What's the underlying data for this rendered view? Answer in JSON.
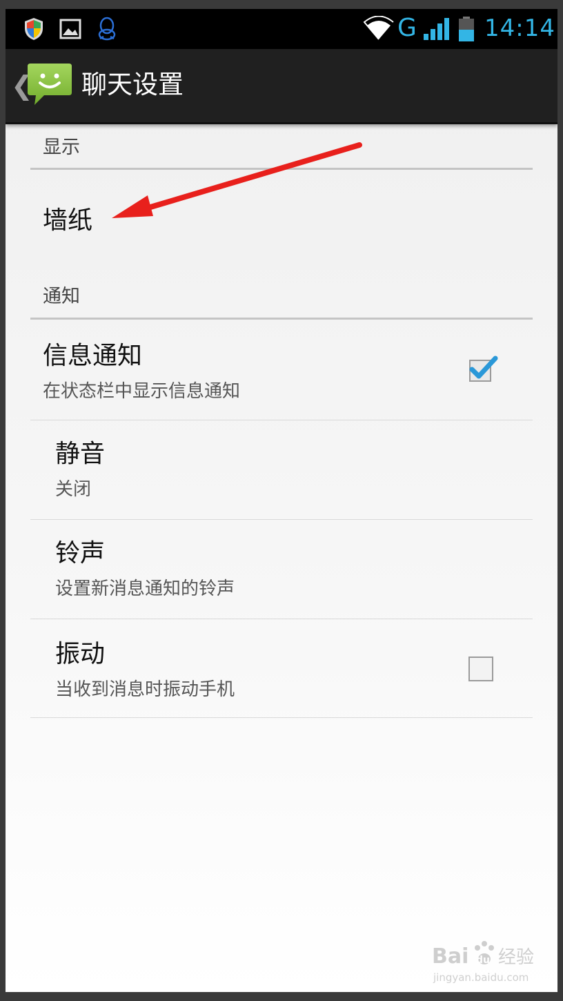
{
  "status_bar": {
    "network_label": "G",
    "time": "14:14",
    "icons": [
      "shield-icon",
      "picture-icon",
      "qq-penguin-icon",
      "wifi-icon",
      "signal-bars-icon",
      "battery-icon"
    ]
  },
  "action_bar": {
    "title": "聊天设置",
    "icons": [
      "back-chevron-icon",
      "messaging-app-icon"
    ]
  },
  "sections": {
    "display": {
      "header": "显示",
      "items": [
        {
          "title": "墙纸"
        }
      ]
    },
    "notifications": {
      "header": "通知",
      "items": [
        {
          "title": "信息通知",
          "summary": "在状态栏中显示信息通知",
          "checkbox": true
        },
        {
          "title": "静音",
          "summary": "关闭"
        },
        {
          "title": "铃声",
          "summary": "设置新消息通知的铃声"
        },
        {
          "title": "振动",
          "summary": "当收到消息时振动手机",
          "checkbox": false
        }
      ]
    }
  },
  "annotation": {
    "type": "red-arrow",
    "color": "#e8201c"
  },
  "watermark": {
    "brand": "Baidu 经验",
    "url": "jingyan.baidu.com"
  },
  "colors": {
    "accent": "#33b5e5",
    "action_bar": "#202020",
    "app_icon_green": "#8dc63f"
  }
}
